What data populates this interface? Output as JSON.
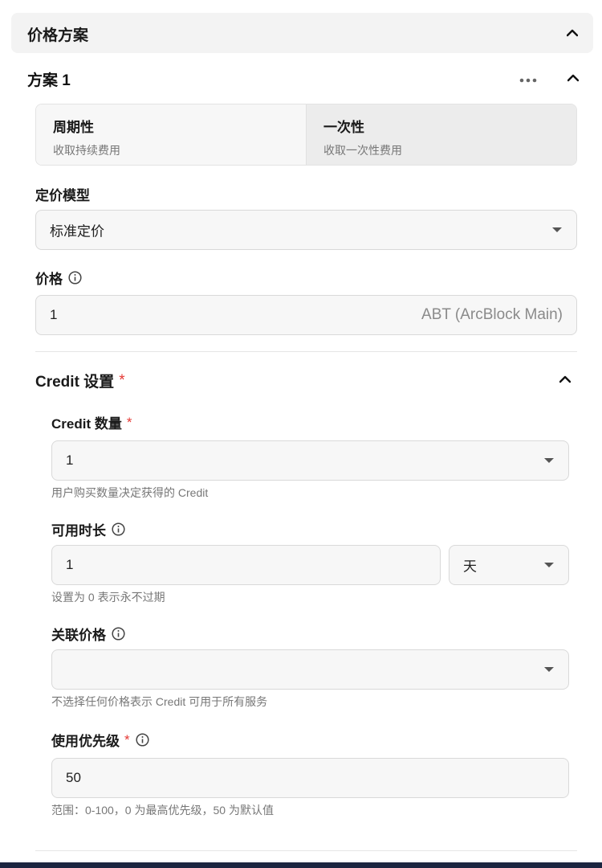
{
  "section": {
    "title": "价格方案"
  },
  "plan": {
    "title": "方案 1"
  },
  "billing": {
    "options": [
      {
        "title": "周期性",
        "subtitle": "收取持续费用"
      },
      {
        "title": "一次性",
        "subtitle": "收取一次性费用"
      }
    ],
    "selected": "一次性"
  },
  "pricing_model": {
    "label": "定价模型",
    "value": "标准定价"
  },
  "price": {
    "label": "价格",
    "value": "1",
    "currency": "ABT (ArcBlock Main)"
  },
  "credit": {
    "title": "Credit 设置",
    "required_mark": "*",
    "quantity": {
      "label": "Credit 数量",
      "value": "1",
      "helper": "用户购买数量决定获得的 Credit"
    },
    "duration": {
      "label": "可用时长",
      "value": "1",
      "unit": "天",
      "helper": "设置为 0 表示永不过期"
    },
    "linked_price": {
      "label": "关联价格",
      "value": "",
      "helper": "不选择任何价格表示 Credit 可用于所有服务"
    },
    "priority": {
      "label": "使用优先级",
      "value": "50",
      "helper": "范围：0-100，0 为最高优先级，50 为默认值"
    }
  }
}
